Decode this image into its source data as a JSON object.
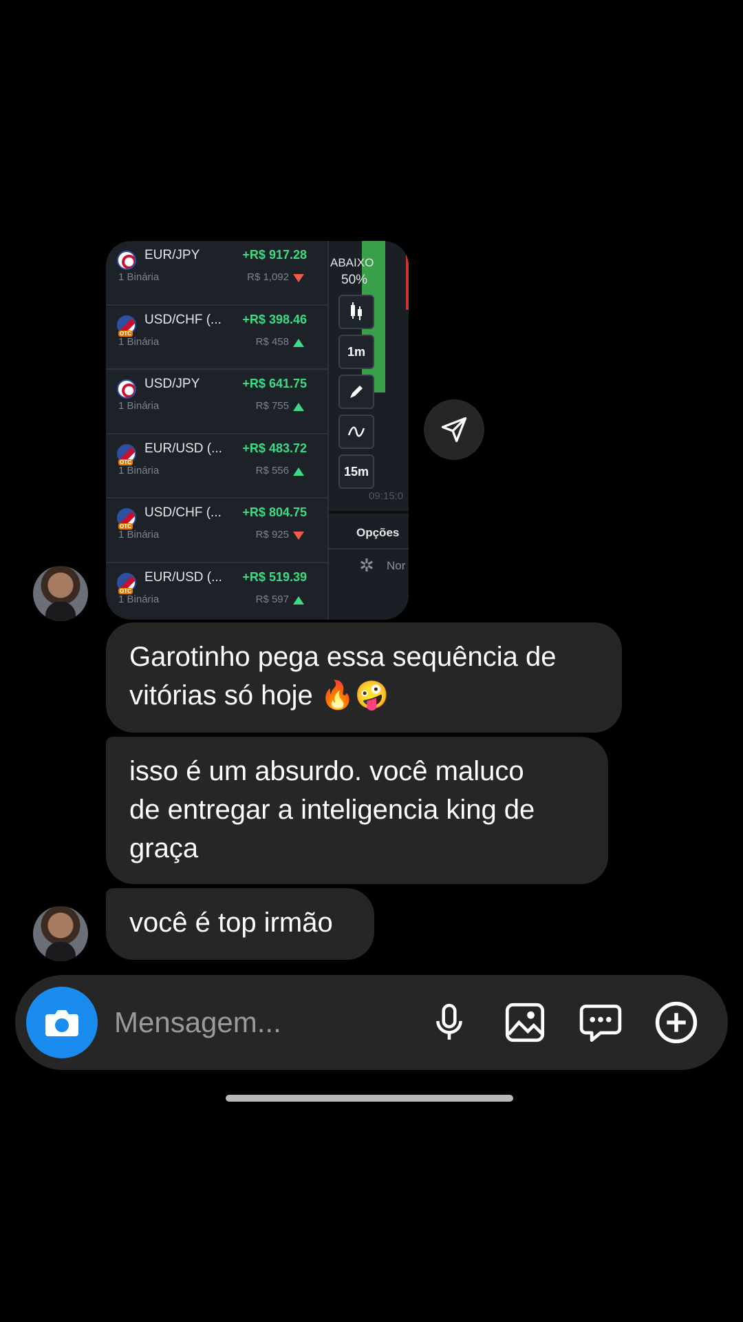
{
  "shared_image": {
    "trades": [
      {
        "pair": "EUR/JPY",
        "type": "1 Binária",
        "profit": "+R$ 917.28",
        "amount": "R$ 1,092",
        "direction": "down",
        "otc": false
      },
      {
        "pair": "USD/CHF (...",
        "type": "1 Binária",
        "profit": "+R$ 398.46",
        "amount": "R$ 458",
        "direction": "up",
        "otc": true
      },
      {
        "pair": "USD/JPY",
        "type": "1 Binária",
        "profit": "+R$ 641.75",
        "amount": "R$ 755",
        "direction": "up",
        "otc": false
      },
      {
        "pair": "EUR/USD (...",
        "type": "1 Binária",
        "profit": "+R$ 483.72",
        "amount": "R$ 556",
        "direction": "up",
        "otc": true
      },
      {
        "pair": "USD/CHF (...",
        "type": "1 Binária",
        "profit": "+R$ 804.75",
        "amount": "R$ 925",
        "direction": "down",
        "otc": true
      },
      {
        "pair": "EUR/USD (...",
        "type": "1 Binária",
        "profit": "+R$ 519.39",
        "amount": "R$ 597",
        "direction": "up",
        "otc": true
      }
    ],
    "otc_tag": "OTC",
    "panel": {
      "below_label": "ABAIXO",
      "percent": "50%",
      "interval_1": "1m",
      "interval_2": "15m",
      "time": "09:15:0",
      "options_label": "Opções",
      "partial_label": "Nor"
    }
  },
  "messages": [
    {
      "lines": [
        "Garotinho pega essa sequência de",
        "vitórias só hoje 🔥🤪"
      ]
    },
    {
      "lines": [
        "isso é um absurdo. você maluco",
        "de  entregar a inteligencia king de",
        "graça"
      ]
    },
    {
      "lines": [
        "você é top irmão"
      ]
    }
  ],
  "composer": {
    "placeholder": "Mensagem...",
    "icons": [
      "camera-icon",
      "microphone-icon",
      "gallery-icon",
      "sticker-chat-icon",
      "add-icon"
    ],
    "camera_color": "#1a8cf0"
  }
}
